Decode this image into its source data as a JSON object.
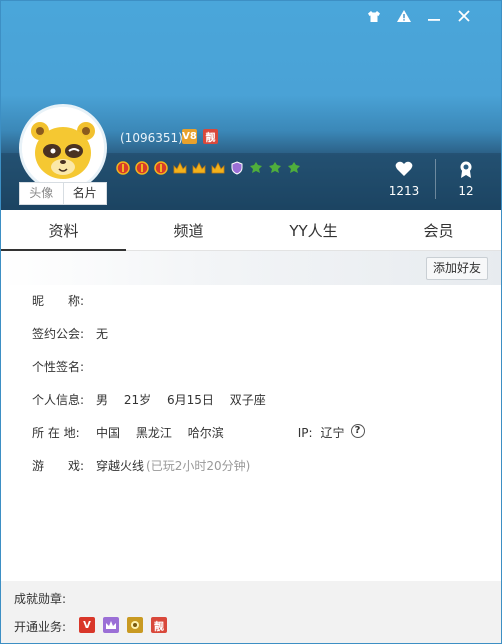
{
  "header": {
    "uid": "(1096351)",
    "uid_badges": [
      {
        "icon": "v8-badge-icon",
        "text": "V8",
        "color": "#e8a12c"
      },
      {
        "icon": "liang-badge-icon",
        "text": "靓",
        "color": "#d9483b"
      }
    ],
    "medals": [
      {
        "icon": "lantern-medal-icon",
        "color": "#d83a2b"
      },
      {
        "icon": "lantern-medal-icon",
        "color": "#d83a2b"
      },
      {
        "icon": "lantern-medal-icon",
        "color": "#d83a2b"
      },
      {
        "icon": "crown-medal-icon",
        "color": "#f3b21c"
      },
      {
        "icon": "crown-medal-icon",
        "color": "#f3b21c"
      },
      {
        "icon": "crown-medal-icon",
        "color": "#f3b21c"
      },
      {
        "icon": "shield-medal-icon",
        "color": "#9b6fd6"
      },
      {
        "icon": "leaf-medal-icon",
        "color": "#4fae3c"
      },
      {
        "icon": "leaf-medal-icon",
        "color": "#4fae3c"
      },
      {
        "icon": "leaf-medal-icon",
        "color": "#4fae3c"
      }
    ],
    "likes": "1213",
    "honors": "12",
    "avatar_buttons": {
      "avatar": "头像",
      "card": "名片"
    }
  },
  "tabs": [
    "资料",
    "频道",
    "YY人生",
    "会员"
  ],
  "toolbar": {
    "add_friend": "添加好友"
  },
  "profile": {
    "nickname_label": "昵　　称:",
    "guild_label": "签约公会:",
    "guild_value": "无",
    "signature_label": "个性签名:",
    "personal_label": "个人信息:",
    "gender": "男",
    "age": "21岁",
    "birthday": "6月15日",
    "zodiac": "双子座",
    "location_label": "所 在 地:",
    "country": "中国",
    "province": "黑龙江",
    "city": "哈尔滨",
    "ip_label": "IP:",
    "ip_value": "辽宁",
    "game_label": "游　　戏:",
    "game_name": "穿越火线",
    "game_time": "(已玩2小时20分钟)"
  },
  "footer": {
    "achievements_label": "成就勋章:",
    "services_label": "开通业务:",
    "services": [
      {
        "icon": "v-service-icon",
        "text": "V",
        "color": "#d9372a"
      },
      {
        "icon": "purple-service-icon",
        "text": "",
        "color": "#9b6fd6"
      },
      {
        "icon": "gold-service-icon",
        "text": "",
        "color": "#c99a22"
      },
      {
        "icon": "liang-service-icon",
        "text": "靓",
        "color": "#d9483b"
      }
    ]
  }
}
